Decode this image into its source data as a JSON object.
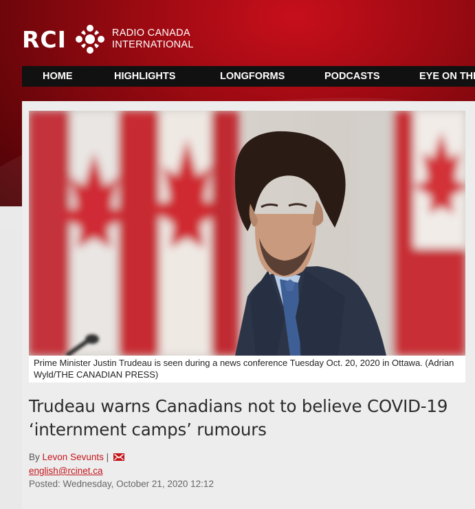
{
  "header": {
    "logo_short": "RCI",
    "logo_name_line1": "RADIO CANADA",
    "logo_name_line2": "INTERNATIONAL"
  },
  "nav": {
    "items": [
      "HOME",
      "HIGHLIGHTS",
      "LONGFORMS",
      "PODCASTS",
      "EYE ON THE"
    ]
  },
  "article": {
    "caption": "Prime Minister Justin Trudeau is seen during a news conference Tuesday Oct. 20, 2020 in Ottawa. (Adrian Wyld/THE CANADIAN PRESS)",
    "title": "Trudeau warns Canadians not to believe COVID-19 ‘internment camps’ rumours",
    "by_label": "By",
    "author": "Levon Sevunts",
    "separator": "|",
    "email": "english@rcinet.ca",
    "posted_label": "Posted:",
    "posted_date": "Wednesday, October 21, 2020 12:12"
  },
  "colors": {
    "brand_red": "#c4151c",
    "nav_bg": "#111111"
  },
  "icons": [
    "radio-canada-gem-icon",
    "mail-icon"
  ]
}
